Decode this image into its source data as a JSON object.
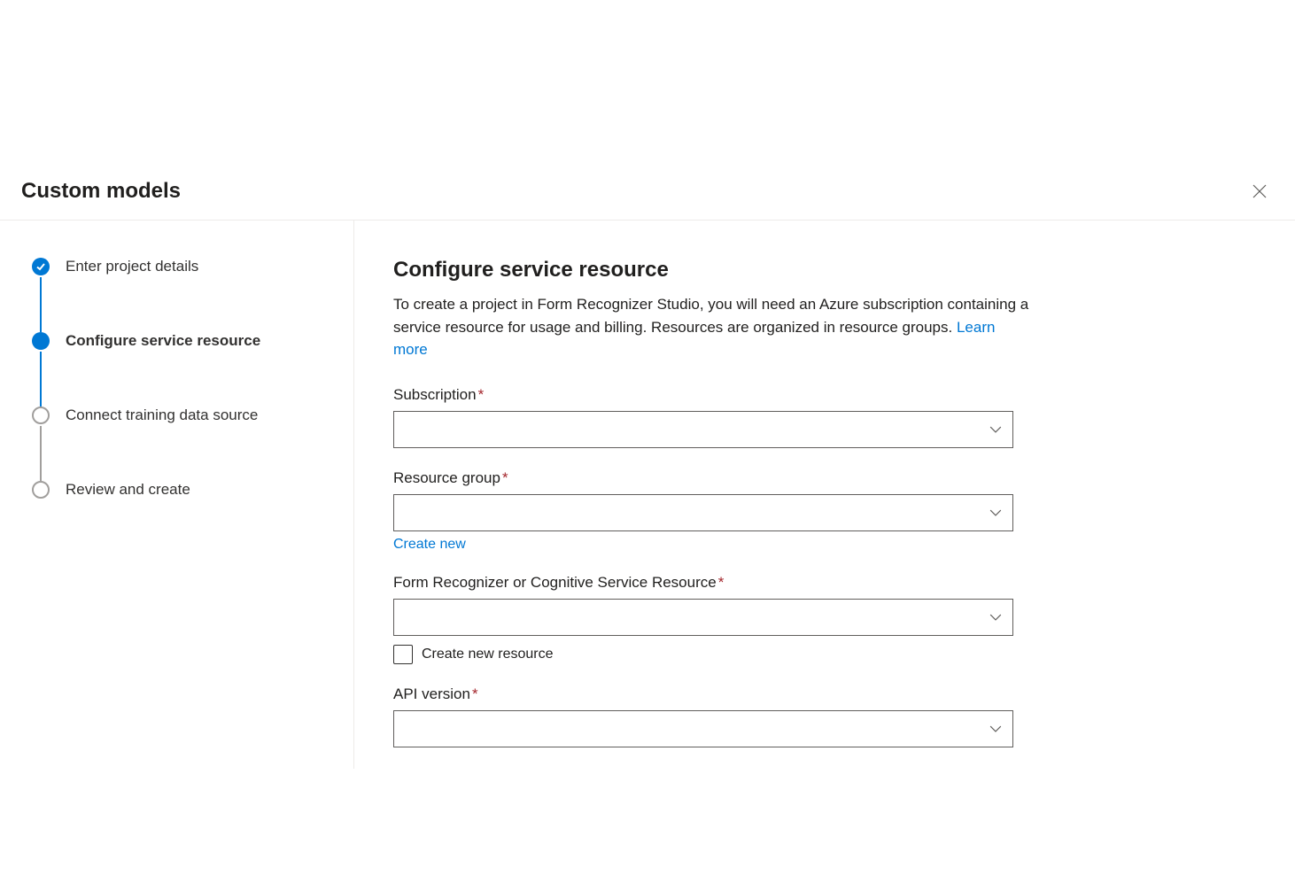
{
  "header": {
    "title": "Custom models"
  },
  "stepper": {
    "steps": [
      {
        "label": "Enter project details"
      },
      {
        "label": "Configure service resource"
      },
      {
        "label": "Connect training data source"
      },
      {
        "label": "Review and create"
      }
    ]
  },
  "main": {
    "title": "Configure service resource",
    "description": "To create a project in Form Recognizer Studio, you will need an Azure subscription containing a service resource for usage and billing. Resources are organized in resource groups. ",
    "learn_more": "Learn more"
  },
  "form": {
    "subscription": {
      "label": "Subscription",
      "value": ""
    },
    "resource_group": {
      "label": "Resource group",
      "value": "",
      "create_new": "Create new"
    },
    "fr_resource": {
      "label": "Form Recognizer or Cognitive Service Resource",
      "value": "",
      "create_new_checkbox": "Create new resource"
    },
    "api_version": {
      "label": "API version",
      "value": ""
    }
  }
}
